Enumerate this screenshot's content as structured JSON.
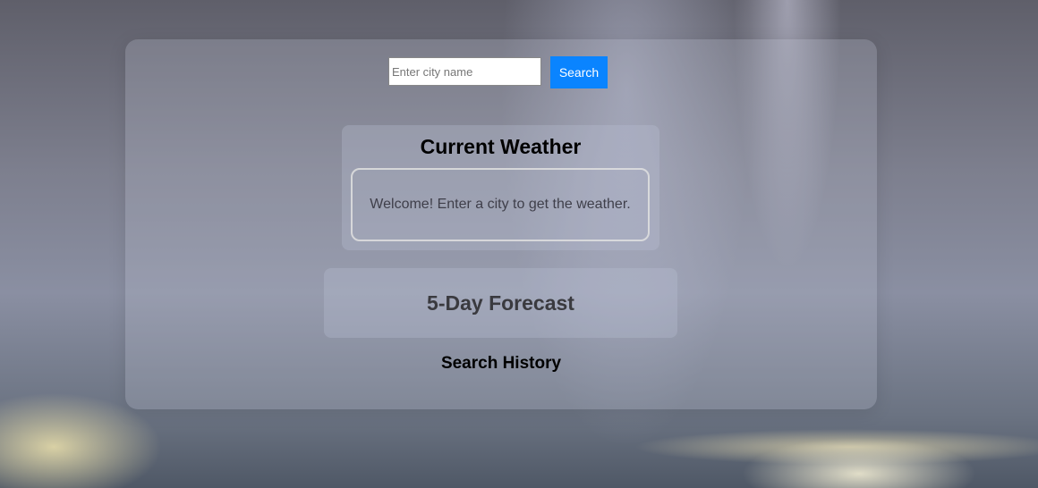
{
  "search": {
    "placeholder": "Enter city name",
    "value": "",
    "button_label": "Search"
  },
  "current_weather": {
    "title": "Current Weather",
    "message": "Welcome! Enter a city to get the weather."
  },
  "forecast": {
    "title": "5-Day Forecast"
  },
  "history": {
    "title": "Search History"
  },
  "colors": {
    "accent": "#0a84ff"
  }
}
